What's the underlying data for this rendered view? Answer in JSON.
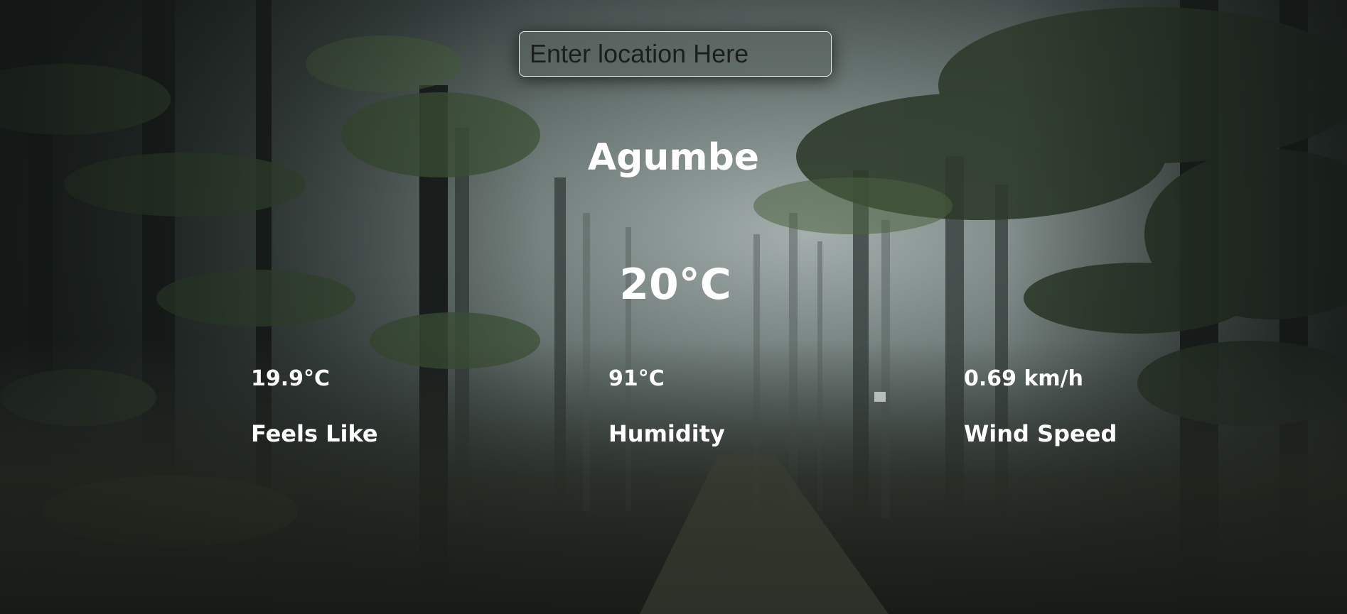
{
  "search": {
    "placeholder": "Enter location Here"
  },
  "weather": {
    "city": "Agumbe",
    "temperature": "20°C",
    "stats": [
      {
        "value": "19.9°C",
        "label": "Feels Like"
      },
      {
        "value": "91°C",
        "label": "Humidity"
      },
      {
        "value": "0.69 km/h",
        "label": "Wind Speed"
      }
    ]
  },
  "colors": {
    "text": "#ffffff",
    "fog": "#8e9a98",
    "forest_dark": "#1a1f1d",
    "foliage": "#3f5438"
  },
  "background": {
    "scene": "misty-pine-forest"
  }
}
